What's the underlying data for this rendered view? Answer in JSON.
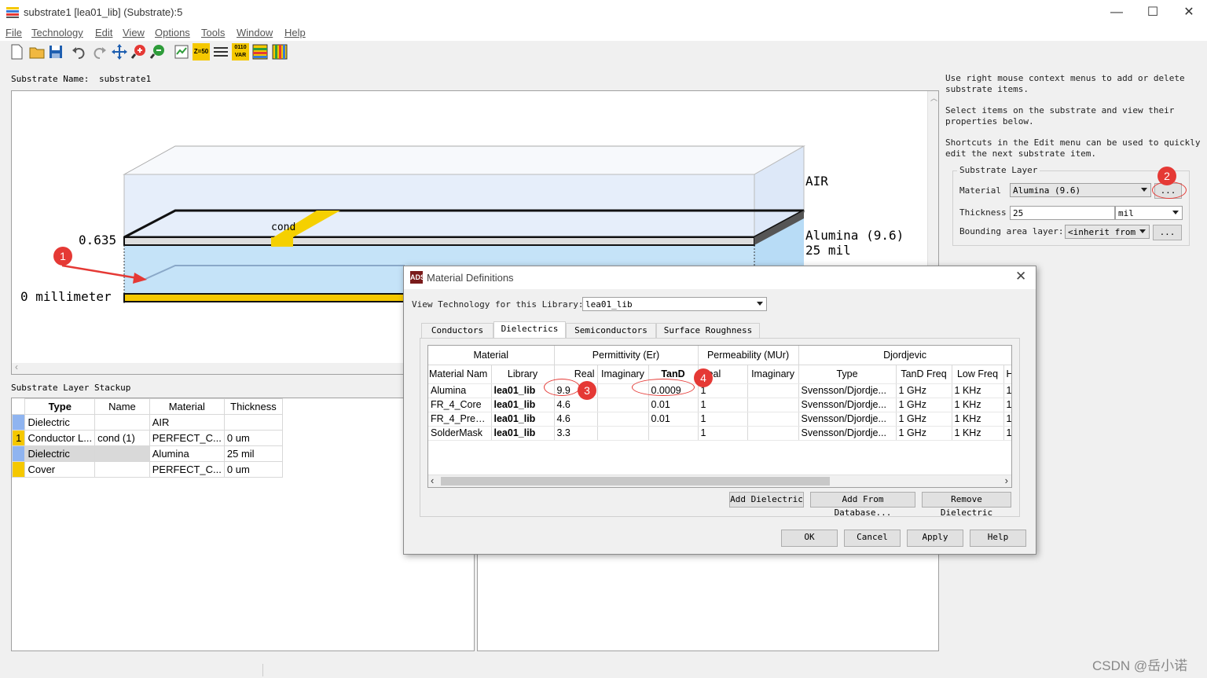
{
  "window": {
    "title": "substrate1 [lea01_lib] (Substrate):5",
    "minimize": "—",
    "maximize": "☐",
    "close": "✕"
  },
  "menu": [
    "File",
    "Technology",
    "Edit",
    "View",
    "Options",
    "Tools",
    "Window",
    "Help"
  ],
  "toolbar": {
    "z50_label": "Z=50",
    "bin_label": "0110",
    "var_label": "VAR"
  },
  "substrate": {
    "name_label": "Substrate Name:",
    "name_value": "substrate1"
  },
  "stack_view": {
    "air_label": "AIR",
    "alumina_label": "Alumina (9.6)",
    "thickness_label": "25 mil",
    "cond_label": "cond",
    "top_height": "0.635",
    "bottom_height": "0 millimeter"
  },
  "layer_stackup": {
    "title": "Substrate Layer Stackup",
    "columns": [
      "Type",
      "Name",
      "Material",
      "Thickness"
    ],
    "rows": [
      {
        "index": "",
        "color": "#8fb4f0",
        "type": "Dielectric",
        "name": "",
        "material": "AIR",
        "thickness": ""
      },
      {
        "index": "1",
        "color": "#f5c800",
        "type": "Conductor L...",
        "name": "cond (1)",
        "material": "PERFECT_C...",
        "thickness": "0 um"
      },
      {
        "index": "",
        "color": "#8fb4f0",
        "type": "Dielectric",
        "name": "",
        "material": "Alumina",
        "thickness": "25 mil"
      },
      {
        "index": "",
        "color": "#f5c800",
        "type": "Cover",
        "name": "",
        "material": "PERFECT_C...",
        "thickness": "0 um"
      }
    ]
  },
  "help_text": {
    "p1": "Use right mouse context menus to add or delete substrate items.",
    "p2": "Select items on the substrate and view their properties below.",
    "p3": "Shortcuts in the Edit menu can be used to quickly edit the next substrate item."
  },
  "substrate_layer": {
    "group_title": "Substrate Layer",
    "material_label": "Material",
    "material_value": "Alumina (9.6)",
    "material_button": "...",
    "thickness_label": "Thickness",
    "thickness_value": "25",
    "thickness_unit": "mil",
    "bounding_label": "Bounding area layer:",
    "bounding_value": "<inherit from",
    "bounding_button": "..."
  },
  "dialog": {
    "title": "Material Definitions",
    "view_tech_label": "View Technology for this Library:",
    "view_tech_value": "lea01_lib",
    "tabs": [
      "Conductors",
      "Dielectrics",
      "Semiconductors",
      "Surface Roughness"
    ],
    "active_tab": 1,
    "group_headers": [
      "Material",
      "Permittivity (Er)",
      "Permeability (MUr)",
      "Djordjevic"
    ],
    "columns": [
      "Material Nam",
      "Library",
      "Real",
      "Imaginary",
      "TanD",
      "Real",
      "Imaginary",
      "Type",
      "TanD Freq",
      "Low Freq",
      "H"
    ],
    "rows": [
      [
        "Alumina",
        "lea01_lib",
        "9.9",
        "",
        "0.0009",
        "1",
        "",
        "Svensson/Djordje...",
        "1 GHz",
        "1 KHz",
        "1"
      ],
      [
        "FR_4_Core",
        "lea01_lib",
        "4.6",
        "",
        "0.01",
        "1",
        "",
        "Svensson/Djordje...",
        "1 GHz",
        "1 KHz",
        "1"
      ],
      [
        "FR_4_Prep...",
        "lea01_lib",
        "4.6",
        "",
        "0.01",
        "1",
        "",
        "Svensson/Djordje...",
        "1 GHz",
        "1 KHz",
        "1"
      ],
      [
        "SolderMask",
        "lea01_lib",
        "3.3",
        "",
        "",
        "1",
        "",
        "Svensson/Djordje...",
        "1 GHz",
        "1 KHz",
        "1"
      ]
    ],
    "add_dielectric": "Add Dielectric",
    "add_from_db": "Add From Database...",
    "remove_dielectric": "Remove Dielectric",
    "ok": "OK",
    "cancel": "Cancel",
    "apply": "Apply",
    "help": "Help"
  },
  "annotations": [
    "1",
    "2",
    "3",
    "4"
  ],
  "watermark": "CSDN @岳小诺"
}
